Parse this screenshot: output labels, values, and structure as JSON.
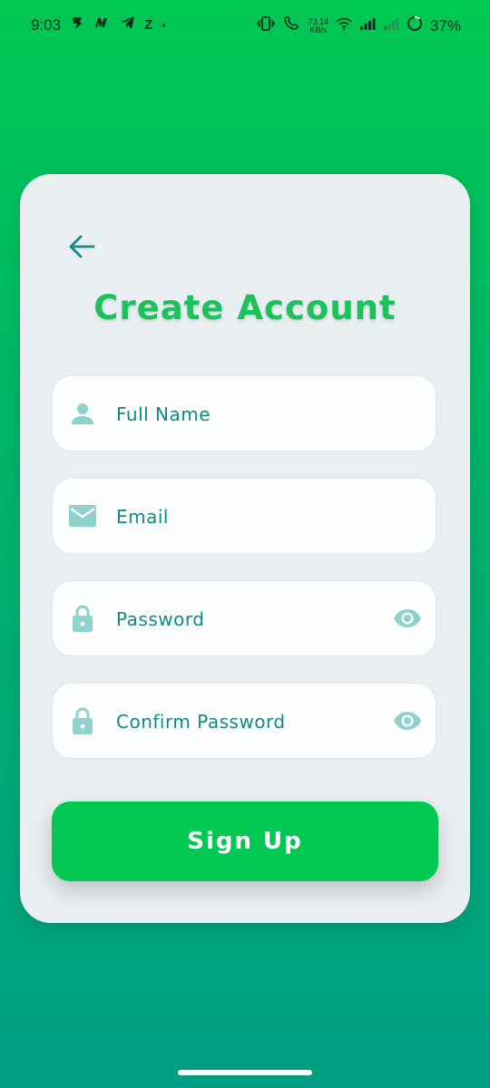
{
  "status_bar": {
    "time": "9:03",
    "notification_icons": [
      "app-notification-icon",
      "app-notification-icon",
      "telegram-icon",
      "z-app-icon"
    ],
    "z_label": "Z",
    "dot": "•",
    "network_speed_value": "73.14",
    "network_speed_unit": "KB/s",
    "battery": "37%"
  },
  "card": {
    "title": "Create Account",
    "back_icon": "arrow-left-icon",
    "fields": [
      {
        "placeholder": "Full Name",
        "icon": "person-icon"
      },
      {
        "placeholder": "Email",
        "icon": "mail-icon"
      },
      {
        "placeholder": "Password",
        "icon": "lock-icon",
        "toggle_icon": "eye-icon"
      },
      {
        "placeholder": "Confirm Password",
        "icon": "lock-icon",
        "toggle_icon": "eye-icon"
      }
    ],
    "signup_label": "Sign Up"
  },
  "colors": {
    "gradient_top": "#00c853",
    "gradient_bottom": "#009e84",
    "card_bg": "#e9eef1",
    "title": "#19c25a",
    "field_text": "#0f8a85",
    "icon": "#8fd1cc",
    "button": "#00c853"
  }
}
